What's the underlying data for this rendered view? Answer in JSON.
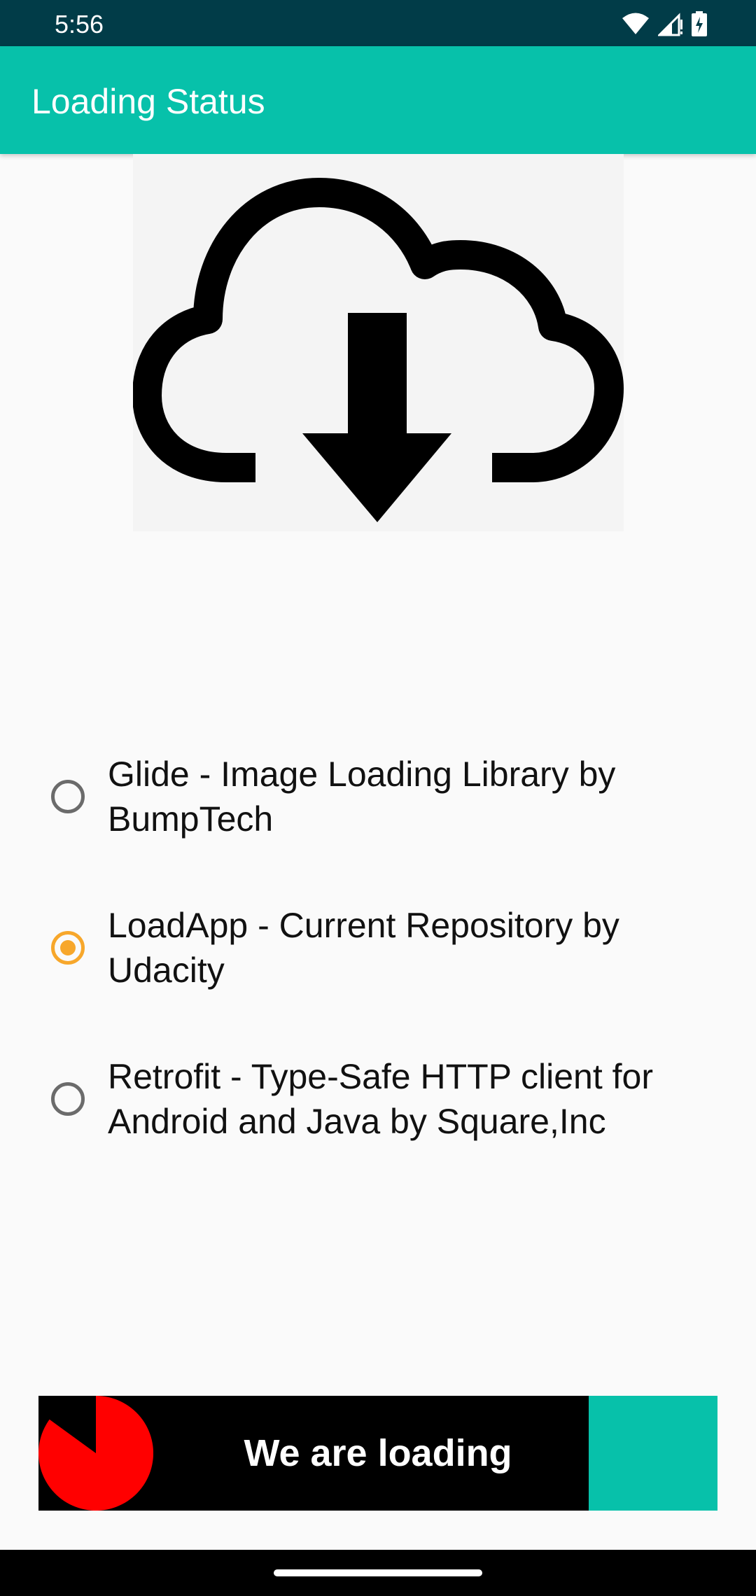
{
  "status_bar": {
    "time": "5:56",
    "icons": [
      "wifi-icon",
      "cellular-signal-icon",
      "battery-charging-icon"
    ]
  },
  "app_bar": {
    "title": "Loading Status"
  },
  "hero": {
    "icon": "cloud-download-icon"
  },
  "radio_group": {
    "options": [
      {
        "label": "Glide - Image Loading Library by BumpTech",
        "checked": false
      },
      {
        "label": "LoadApp - Current Repository by Udacity",
        "checked": true
      },
      {
        "label": "Retrofit - Type-Safe HTTP client for Android and Java by Square,Inc",
        "checked": false
      }
    ]
  },
  "load_button": {
    "label": "We are loading",
    "progress_fraction": 0.81,
    "arc_fraction": 0.85,
    "colors": {
      "background": "#000000",
      "progress": "#07c1aa",
      "arc": "#ff0000",
      "text": "#ffffff"
    }
  },
  "colors": {
    "app_bar": "#07c1aa",
    "status_bar": "#013c48",
    "radio_checked": "#f7a72b"
  }
}
